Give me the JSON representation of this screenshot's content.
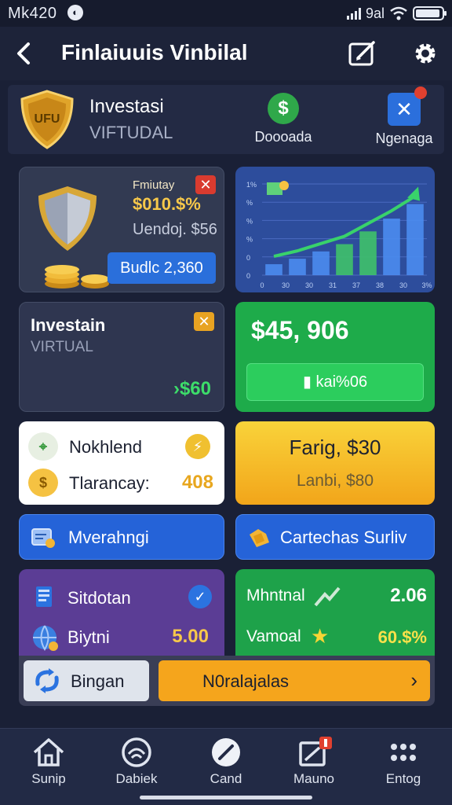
{
  "status": {
    "time": "Mk420",
    "carrier": "9al"
  },
  "header": {
    "title": "Finlaiuuis Vinbilal"
  },
  "account": {
    "badge_text": "UFU",
    "title": "Investasi",
    "subtitle": "VIFTUDAL",
    "quick_actions": [
      {
        "label": "Doooada",
        "icon": "dollar-icon"
      },
      {
        "label": "Ngenaga",
        "icon": "close-icon"
      }
    ]
  },
  "card_security": {
    "label": "Fmiutay",
    "percent": "$010.$%",
    "value": "Uendoj. $56",
    "button": "Budlc 2,360"
  },
  "card_chart": {
    "chart_data": {
      "type": "bar",
      "x_ticks": [
        "0",
        "30",
        "30",
        "31",
        "37",
        "38",
        "30",
        "3%"
      ],
      "y_ticks": [
        "1%",
        "%",
        "%",
        "%",
        "0",
        "0"
      ],
      "values": [
        12,
        18,
        26,
        34,
        48,
        62,
        78
      ],
      "trend": "up"
    }
  },
  "card_virtual": {
    "title": "Investain",
    "subtitle": "VIRTUAL",
    "value": "›$60"
  },
  "card_total": {
    "value": "$45, 906",
    "button": "kai%06"
  },
  "card_list": {
    "items": [
      {
        "label": "Nokhlend",
        "badge": "⚡"
      },
      {
        "label": "Tlarancay:",
        "value": "408"
      }
    ]
  },
  "card_promo": {
    "title": "Farig, $30",
    "subtitle": "Lanbi, $80"
  },
  "btn_left": {
    "label": "Mverahngi"
  },
  "btn_right": {
    "label": "Cartechas Surliv"
  },
  "card_purple": {
    "row1": "Sitdotan",
    "row2": "Biytni",
    "value": "5.00"
  },
  "card_green": {
    "row1": "Mhntnal",
    "value1": "2.06",
    "row2": "Vamoal",
    "value2": "60.$%"
  },
  "actions": {
    "left": "Bingan",
    "right": "N0ralajalas"
  },
  "nav": [
    {
      "label": "Sunip"
    },
    {
      "label": "Dabiek"
    },
    {
      "label": "Cand"
    },
    {
      "label": "Mauno"
    },
    {
      "label": "Entog"
    }
  ],
  "colors": {
    "bg": "#1a2036",
    "green": "#1eab4a",
    "blue": "#2563d8",
    "gold": "#f5a51c",
    "purple": "#5b3d95"
  }
}
